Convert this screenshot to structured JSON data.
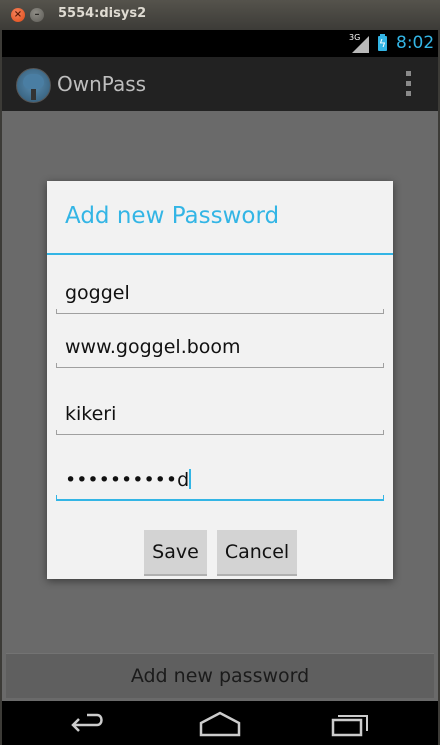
{
  "window": {
    "title": "5554:disys2"
  },
  "status_bar": {
    "network": "3G",
    "time": "8:02",
    "accent_color": "#33b5e5"
  },
  "action_bar": {
    "app_title": "OwnPass",
    "overflow_icon": "more-vert-icon"
  },
  "dialog": {
    "title": "Add new Password",
    "fields": [
      {
        "value": "goggel"
      },
      {
        "value": "www.goggel.boom"
      },
      {
        "value": "kikeri"
      },
      {
        "value": "••••••••••d"
      }
    ],
    "buttons": {
      "save": "Save",
      "cancel": "Cancel"
    }
  },
  "main": {
    "add_new_button": "Add new password"
  },
  "nav_bar": {
    "back_icon": "back-icon",
    "home_icon": "home-icon",
    "recents_icon": "recents-icon"
  }
}
